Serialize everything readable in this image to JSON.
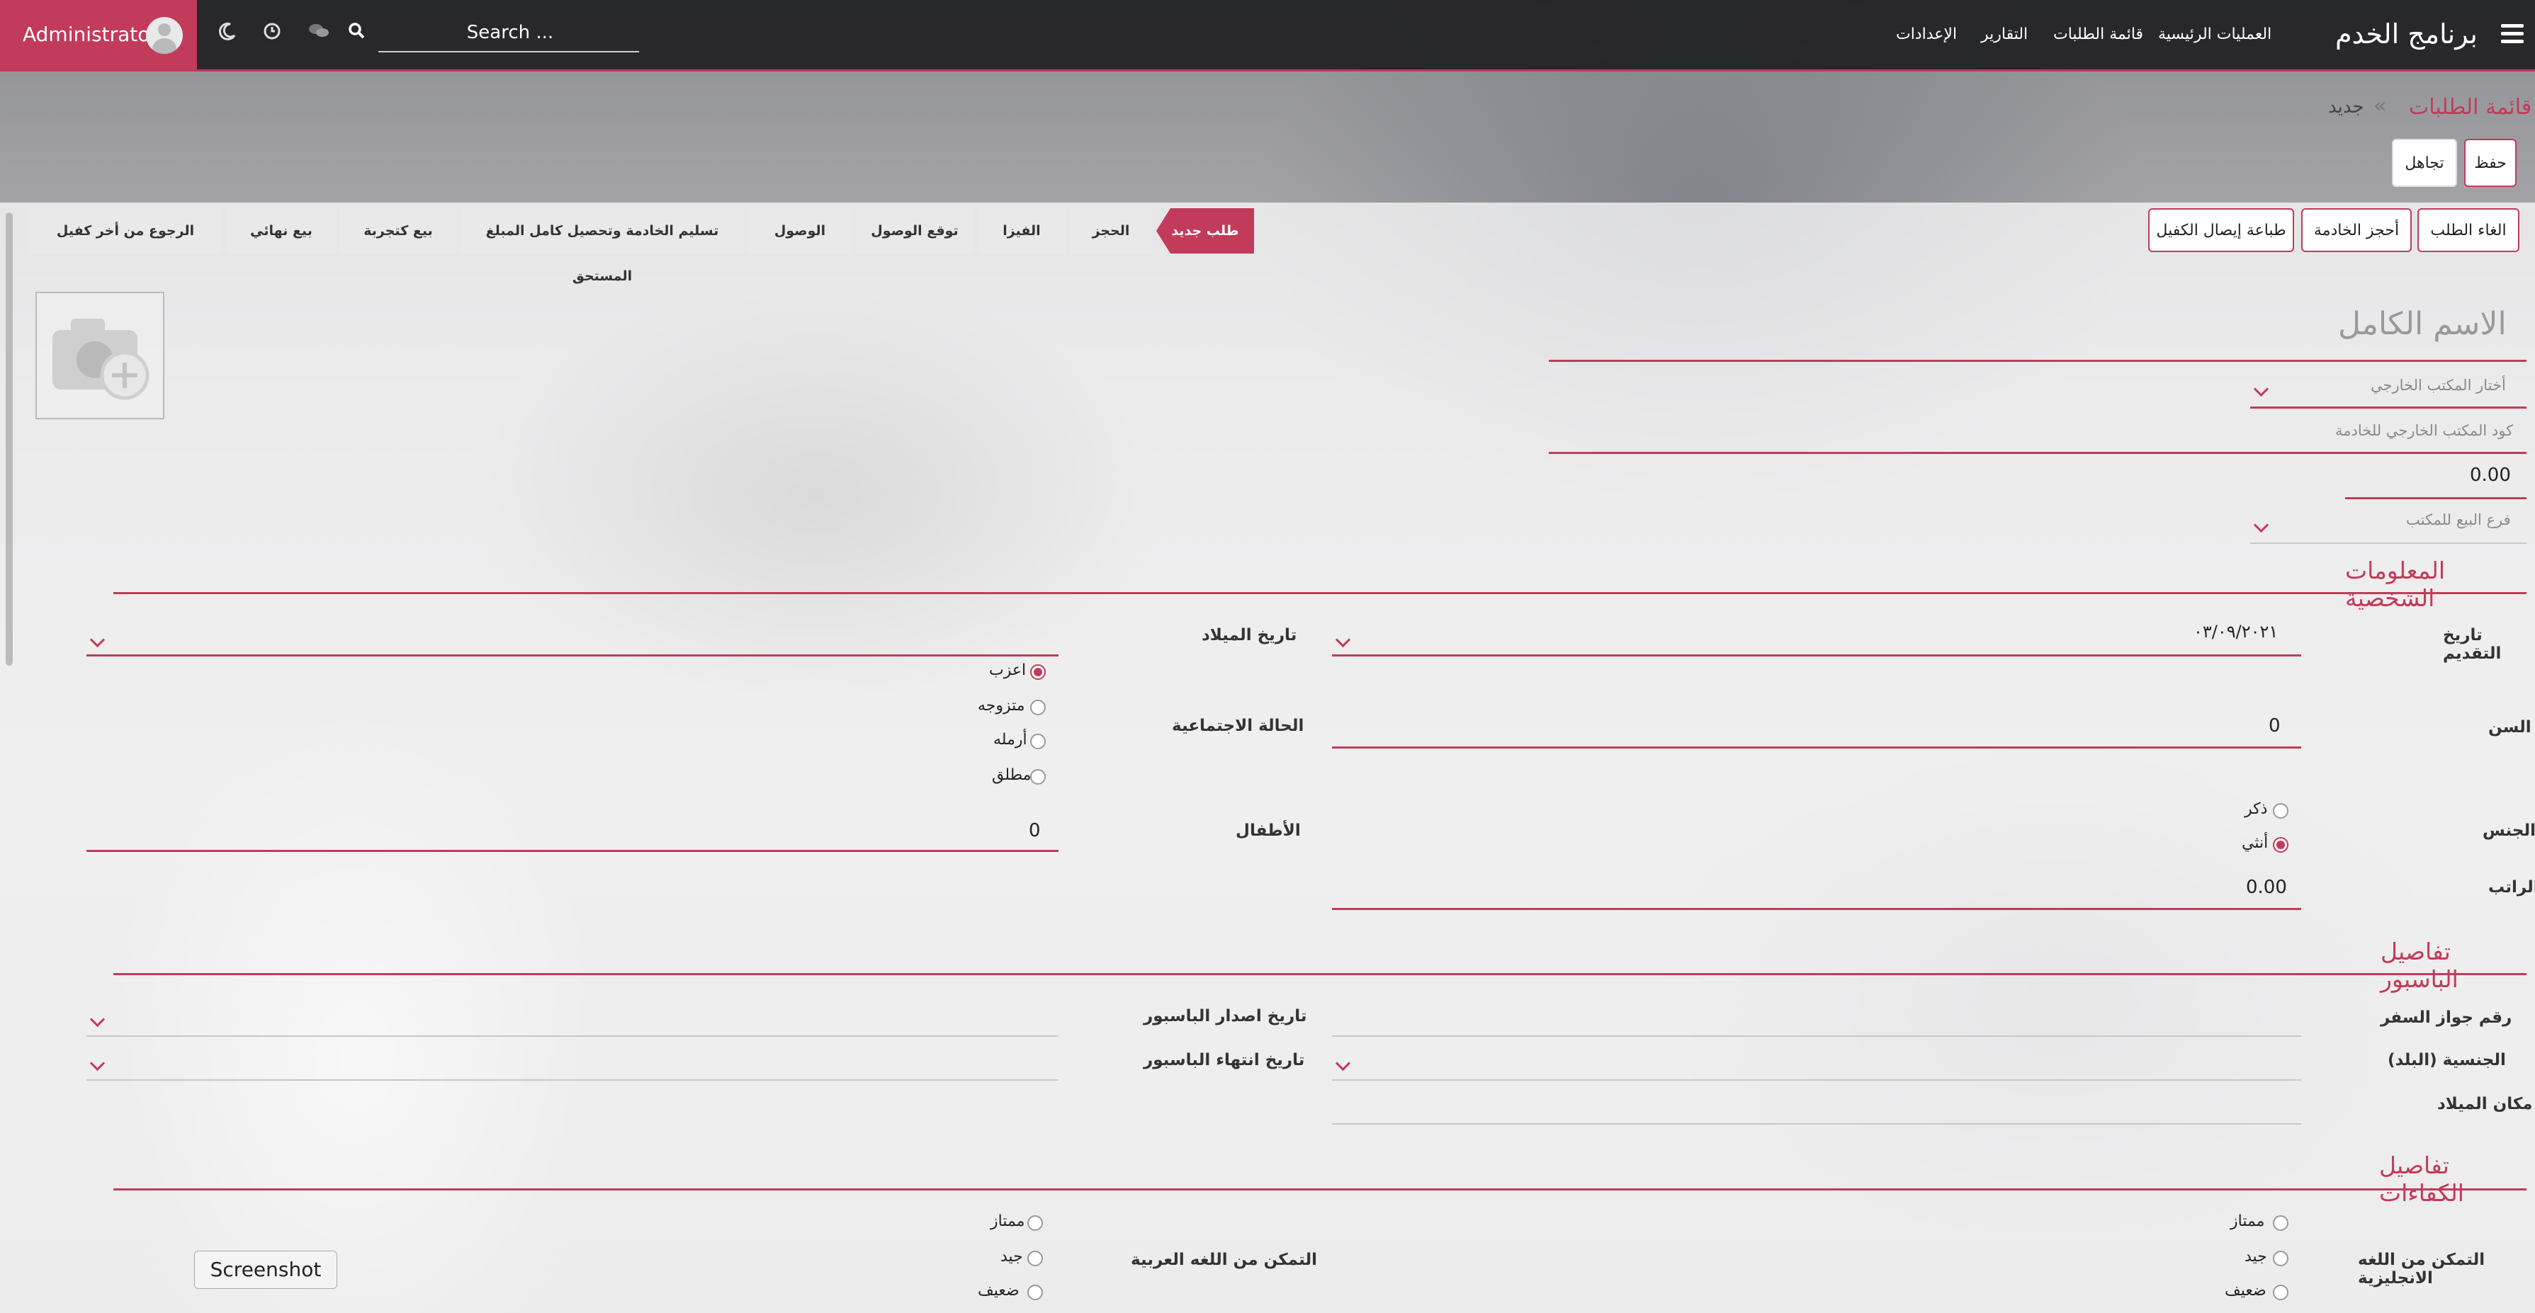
{
  "app": {
    "brand": "برنامج الخدم"
  },
  "nav": {
    "items": [
      "العمليات الرئيسية",
      "قائمة الطلبات",
      "التقارير",
      "الإعدادات"
    ]
  },
  "search": {
    "placeholder": "Search ..."
  },
  "user": {
    "name": "Administrator"
  },
  "topicons": [
    "moon-icon",
    "clock-icon",
    "chat-icon",
    "search-icon"
  ],
  "breadcrumb": {
    "parent": "قائمة الطلبات",
    "separator": "«",
    "current": "جديد"
  },
  "actions": {
    "save": "حفظ",
    "discard": "تجاهل"
  },
  "header_buttons": {
    "cancel": "الغاء الطلب",
    "book_maid": "أحجز الخادمة",
    "print_receipt": "طباعة إيصال الكفيل"
  },
  "status_steps": [
    "طلب جديد",
    "الحجز",
    "الفيزا",
    "توقع الوصول",
    "الوصول",
    "تسليم الخادمة وتحصيل كامل المبلغ المستحق",
    "بيع كتجربة",
    "بيع نهائي",
    "الرجوع من أخر كفيل"
  ],
  "form": {
    "full_name_placeholder": "الاسم الكامل",
    "foreign_office_placeholder": "أختار المكتب الخارجي",
    "foreign_office_code_placeholder": "كود المكتب الخارجي للخادمة",
    "amount": "0.00",
    "sales_branch_placeholder": "فرع البيع للمكتب"
  },
  "personal": {
    "title": "المعلومات الشخصية",
    "apply_date_label": "تاريخ التقديم",
    "apply_date": "٠٣/٠٩/٢٠٢١",
    "birth_date_label": "تاريخ الميلاد",
    "age_label": "السن",
    "age": "0",
    "marital_label": "الحالة الاجتماعية",
    "marital_options": [
      "اعزب",
      "متزوجه",
      "أرمله",
      "مطلق"
    ],
    "gender_label": "الجنس",
    "gender_options": [
      "ذكر",
      "أنثي"
    ],
    "children_label": "الأطفال",
    "children": "0",
    "salary_label": "الراتب",
    "salary": "0.00"
  },
  "passport": {
    "title": "تفاصيل الباسبور",
    "number_label": "رقم جواز السفر",
    "issue_label": "تاريخ اصدار الباسبور",
    "nationality_label": "الجنسية (البلد)",
    "expiry_label": "تاريخ انتهاء الباسبور",
    "birthplace_label": "مكان الميلاد"
  },
  "skills": {
    "title": "تفاصيل الكفاءات",
    "english_label": "التمكن من اللغه الانجليزية",
    "arabic_label": "التمكن من اللغه العربية",
    "levels": [
      "ممتاز",
      "جيد",
      "ضعيف"
    ]
  },
  "tooltip": {
    "label": "Screenshot"
  },
  "colors": {
    "accent": "#c23b5a"
  }
}
